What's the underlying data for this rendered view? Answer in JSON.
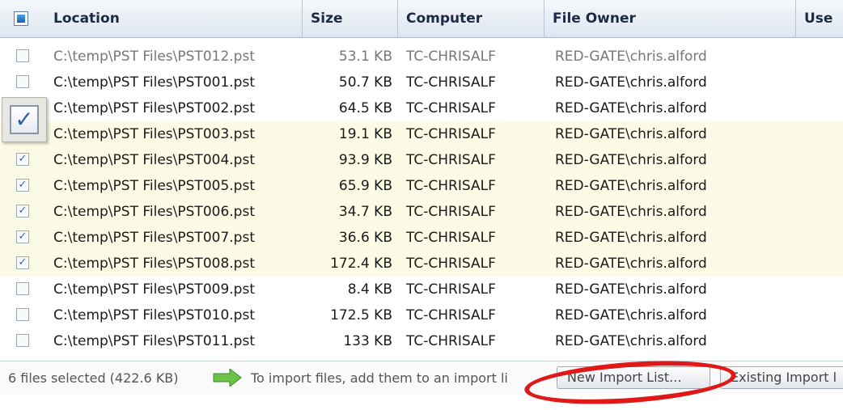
{
  "columns": {
    "location": "Location",
    "size": "Size",
    "computer": "Computer",
    "owner": "File Owner",
    "user": "Use"
  },
  "rows": [
    {
      "location": "C:\\temp\\PST Files\\PST012.pst",
      "size": "53.1 KB",
      "computer": "TC-CHRISALF",
      "owner": "RED-GATE\\chris.alford",
      "checked": false,
      "dim": true
    },
    {
      "location": "C:\\temp\\PST Files\\PST001.pst",
      "size": "50.7 KB",
      "computer": "TC-CHRISALF",
      "owner": "RED-GATE\\chris.alford",
      "checked": false
    },
    {
      "location": "C:\\temp\\PST Files\\PST002.pst",
      "size": "64.5 KB",
      "computer": "TC-CHRISALF",
      "owner": "RED-GATE\\chris.alford",
      "checked": false
    },
    {
      "location": "C:\\temp\\PST Files\\PST003.pst",
      "size": "19.1 KB",
      "computer": "TC-CHRISALF",
      "owner": "RED-GATE\\chris.alford",
      "checked": true
    },
    {
      "location": "C:\\temp\\PST Files\\PST004.pst",
      "size": "93.9 KB",
      "computer": "TC-CHRISALF",
      "owner": "RED-GATE\\chris.alford",
      "checked": true
    },
    {
      "location": "C:\\temp\\PST Files\\PST005.pst",
      "size": "65.9 KB",
      "computer": "TC-CHRISALF",
      "owner": "RED-GATE\\chris.alford",
      "checked": true
    },
    {
      "location": "C:\\temp\\PST Files\\PST006.pst",
      "size": "34.7 KB",
      "computer": "TC-CHRISALF",
      "owner": "RED-GATE\\chris.alford",
      "checked": true
    },
    {
      "location": "C:\\temp\\PST Files\\PST007.pst",
      "size": "36.6 KB",
      "computer": "TC-CHRISALF",
      "owner": "RED-GATE\\chris.alford",
      "checked": true
    },
    {
      "location": "C:\\temp\\PST Files\\PST008.pst",
      "size": "172.4 KB",
      "computer": "TC-CHRISALF",
      "owner": "RED-GATE\\chris.alford",
      "checked": true
    },
    {
      "location": "C:\\temp\\PST Files\\PST009.pst",
      "size": "8.4 KB",
      "computer": "TC-CHRISALF",
      "owner": "RED-GATE\\chris.alford",
      "checked": false
    },
    {
      "location": "C:\\temp\\PST Files\\PST010.pst",
      "size": "172.5 KB",
      "computer": "TC-CHRISALF",
      "owner": "RED-GATE\\chris.alford",
      "checked": false
    },
    {
      "location": "C:\\temp\\PST Files\\PST011.pst",
      "size": "133 KB",
      "computer": "TC-CHRISALF",
      "owner": "RED-GATE\\chris.alford",
      "checked": false
    }
  ],
  "status": {
    "selection": "6 files selected (422.6 KB)",
    "hint": "To import files, add them to an import li",
    "new_list_button": "New Import List...",
    "existing_list_button": "Existing Import l"
  },
  "colors": {
    "highlight_row": "#fbfbe6",
    "annotation_ring": "#e01818",
    "arrow": "#6cc24a"
  }
}
